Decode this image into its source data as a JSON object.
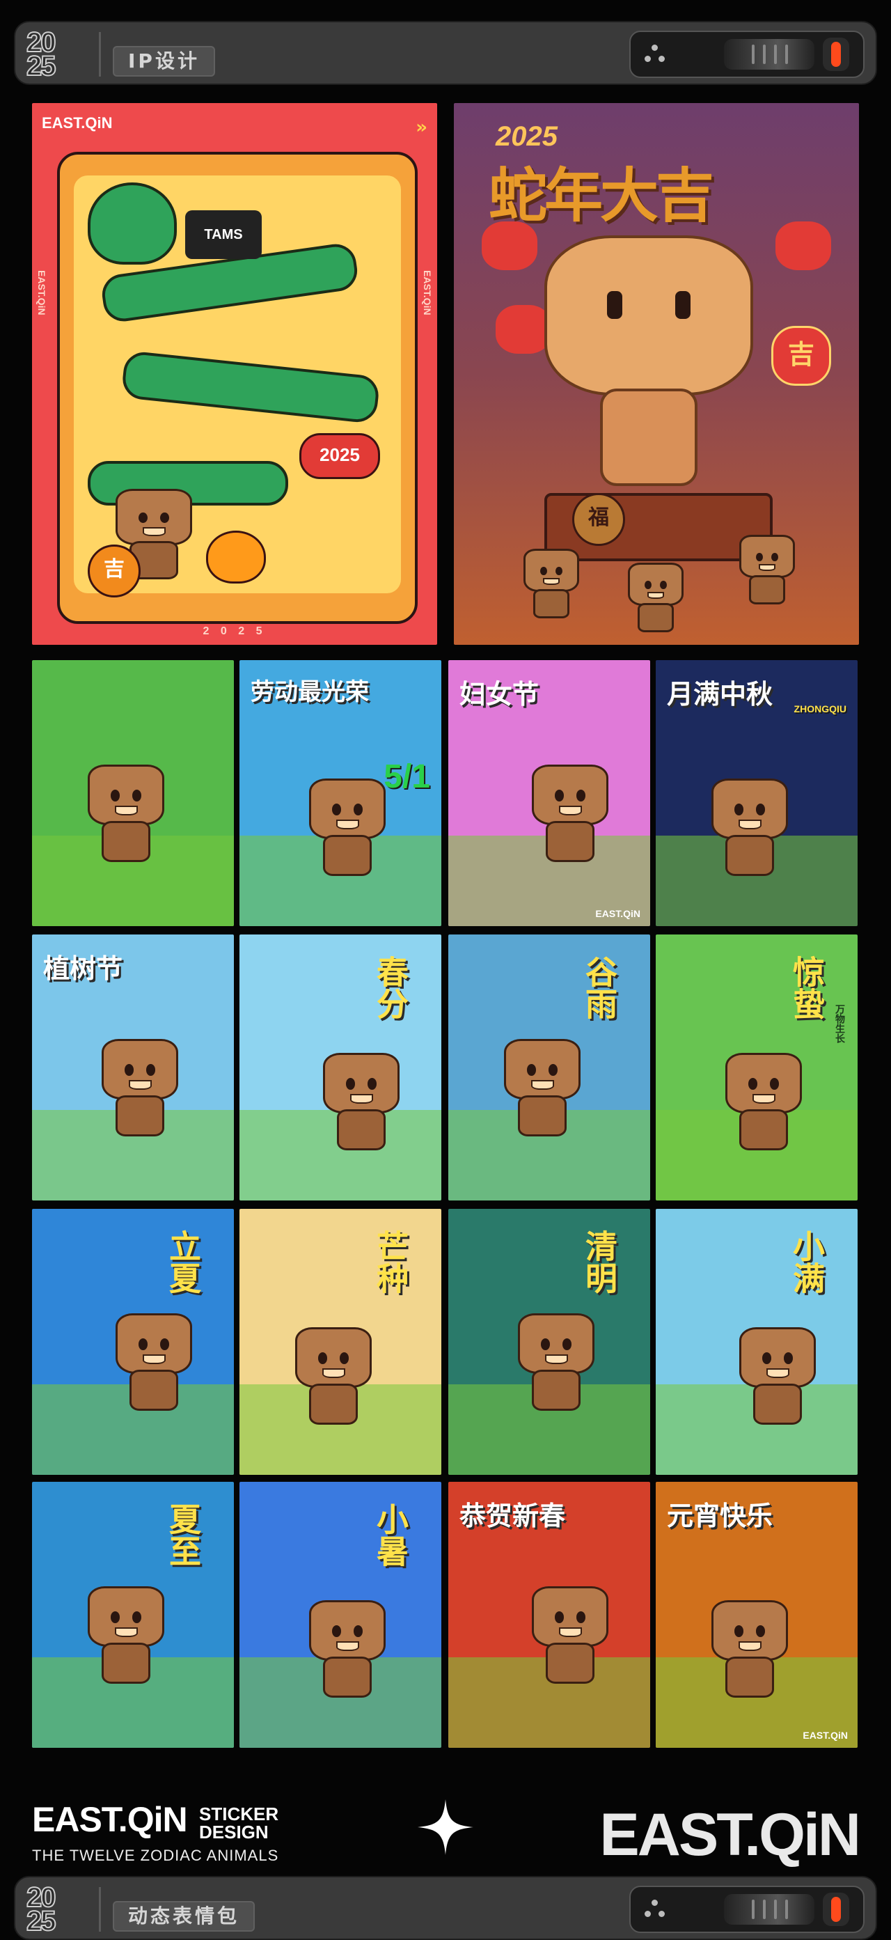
{
  "header": {
    "year_top": "20",
    "year_bottom": "25",
    "tag": "IP设计"
  },
  "footer_bar": {
    "year_top": "20",
    "year_bottom": "25",
    "tag": "动态表情包"
  },
  "big_posters": {
    "p1": {
      "brand": "EAST.QiN",
      "side": "EAST.QiN",
      "year": "2025",
      "bottom_year": "2 0 2 5",
      "badge": "吉",
      "sign": "TAMS"
    },
    "p2": {
      "year": "2025",
      "title": "蛇年大吉",
      "badge": "吉",
      "coin": "福"
    }
  },
  "posters": [
    {
      "title": "",
      "bg": "#56b94a"
    },
    {
      "title": "劳动最光荣",
      "sub": "5/1",
      "bg": "#44a9e0"
    },
    {
      "title": "妇女节",
      "bg": "#e07ad8",
      "brand": "EAST.QiN"
    },
    {
      "title": "月满中秋",
      "sub": "ZHONGQIU",
      "bg": "#1c2a5e"
    },
    {
      "title": "植树节",
      "bg": "#7cc6ea"
    },
    {
      "title": "春分",
      "bg": "#8ed4f0"
    },
    {
      "title": "谷雨",
      "bg": "#5aa6d2"
    },
    {
      "title": "惊蛰",
      "side": "万物生长",
      "bg": "#68c451"
    },
    {
      "title": "立夏",
      "bg": "#2f86d8"
    },
    {
      "title": "芒种",
      "bg": "#f2d68e"
    },
    {
      "title": "清明",
      "bg": "#2a7a6a"
    },
    {
      "title": "小满",
      "bg": "#7ccbe8"
    },
    {
      "title": "夏至",
      "bg": "#2e8ed0"
    },
    {
      "title": "小暑",
      "bg": "#3a7ae0"
    },
    {
      "title": "恭贺新春",
      "bg": "#d4402a"
    },
    {
      "title": "元宵快乐",
      "bg": "#d0701c",
      "brand": "EAST.QiN"
    }
  ],
  "footer": {
    "logo_left": "EAST.QiN",
    "sticker": "STICKER",
    "design": "DESIGN",
    "subtitle": "THE TWELVE ZODIAC ANIMALS",
    "logo_right": "EAST.QiN"
  },
  "colors": {
    "bar": "#3a3a3a",
    "accent": "#ff4a1c",
    "page_bg": "#050505"
  }
}
